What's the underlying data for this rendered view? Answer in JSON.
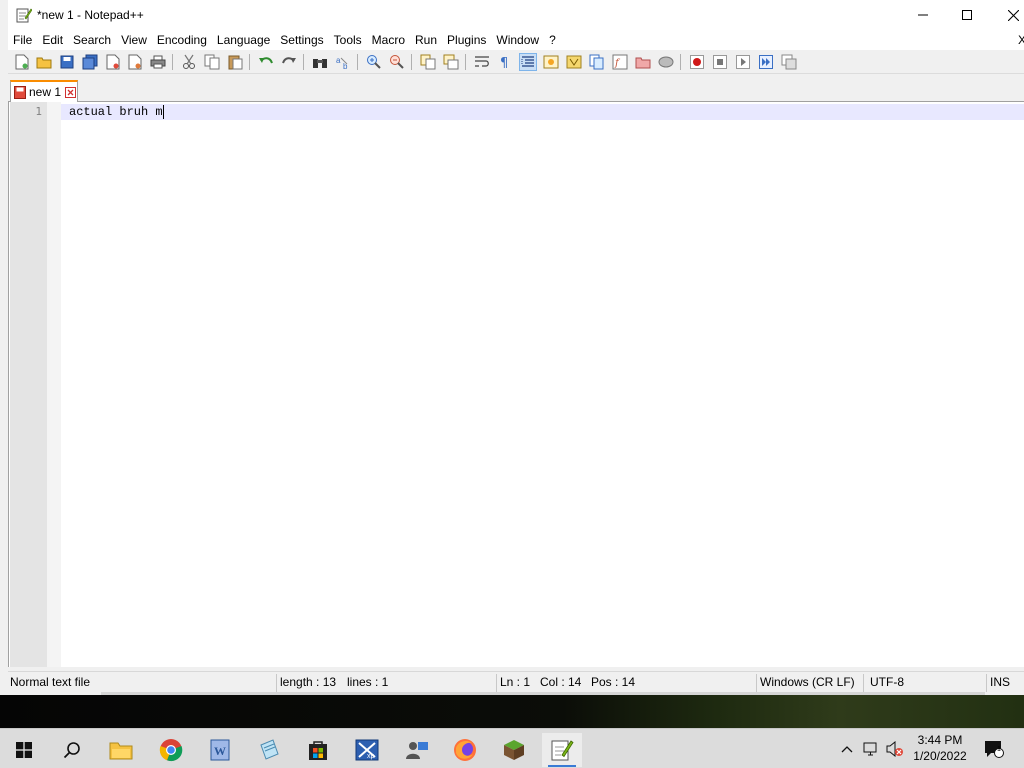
{
  "window": {
    "title": "*new 1 - Notepad++"
  },
  "menubar": {
    "items": [
      "File",
      "Edit",
      "Search",
      "View",
      "Encoding",
      "Language",
      "Settings",
      "Tools",
      "Macro",
      "Run",
      "Plugins",
      "Window",
      "?"
    ],
    "overflow_close": "X"
  },
  "tabs": [
    {
      "label": "new 1",
      "modified": true,
      "active": true
    }
  ],
  "editor": {
    "lines": [
      {
        "number": "1",
        "text": "actual bruh m"
      }
    ]
  },
  "statusbar": {
    "file_type": "Normal text file",
    "length": "length : 13",
    "lines": "lines : 1",
    "ln": "Ln : 1",
    "col": "Col : 14",
    "pos": "Pos : 14",
    "eol": "Windows (CR LF)",
    "encoding": "UTF-8",
    "mode": "INS"
  },
  "taskbar": {
    "apps": [
      "start-icon",
      "search-icon",
      "file-explorer-icon",
      "chrome-icon",
      "word-icon",
      "notepad-icon",
      "store-icon",
      "xp-vm-icon",
      "people-icon",
      "firefox-icon",
      "minecraft-icon",
      "notepadpp-icon"
    ],
    "clock": {
      "time": "3:44 PM",
      "date": "1/20/2022"
    },
    "notification_count": "1"
  },
  "colors": {
    "tab_accent": "#fa8c00",
    "current_line": "#e8e8ff",
    "gutter": "#e4e4e4"
  }
}
